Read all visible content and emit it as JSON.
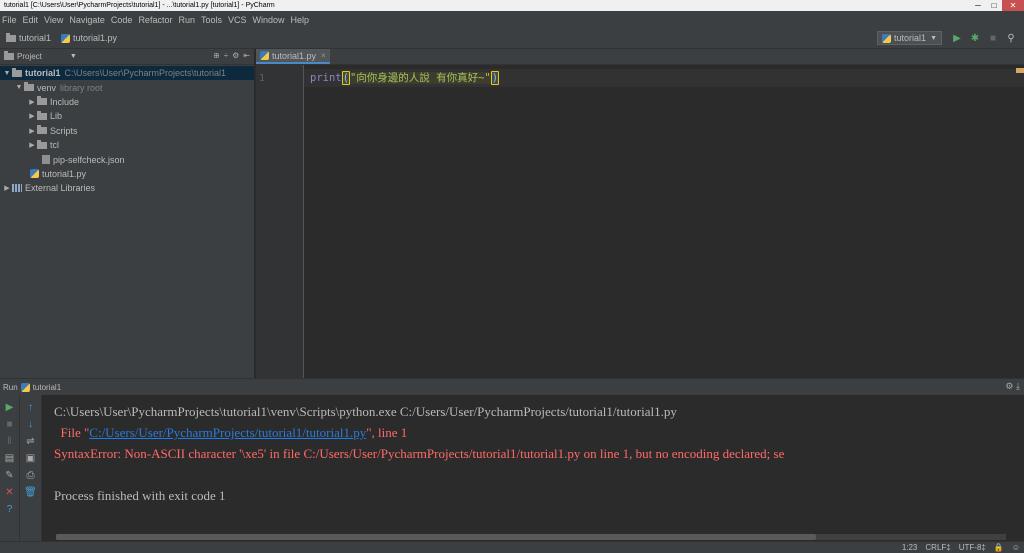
{
  "window": {
    "title": "tutorial1 [C:\\Users\\User\\PycharmProjects\\tutorial1] - ...\\tutorial1.py [tutorial1] - PyCharm",
    "controls": [
      "─",
      "□",
      "✕"
    ]
  },
  "menu": [
    "File",
    "Edit",
    "View",
    "Navigate",
    "Code",
    "Refactor",
    "Run",
    "Tools",
    "VCS",
    "Window",
    "Help"
  ],
  "breadcrumb": {
    "project": "tutorial1",
    "file": "tutorial1.py"
  },
  "toolbar": {
    "run_config": "tutorial1",
    "run_icon": "run-icon",
    "debug_icon": "debug-icon",
    "stop_icon": "stop-icon",
    "search_icon": "search-icon"
  },
  "project_panel": {
    "title": "Project",
    "tree": {
      "root_label": "tutorial1",
      "root_path": "C:\\Users\\User\\PycharmProjects\\tutorial1",
      "venv_label": "venv",
      "venv_hint": "library root",
      "include": "Include",
      "lib": "Lib",
      "scripts": "Scripts",
      "tcl": "tcl",
      "pip_file": "pip-selfcheck.json",
      "main_file": "tutorial1.py",
      "external": "External Libraries"
    }
  },
  "editor": {
    "tab_label": "tutorial1.py",
    "line_number": "1",
    "code_keyword": "print",
    "code_open": "(",
    "code_string": "\"向你身邊的人說 有你真好~\"",
    "code_close": ")"
  },
  "run_panel": {
    "title": "Run",
    "config": "tutorial1",
    "console": {
      "line1": "C:\\Users\\User\\PycharmProjects\\tutorial1\\venv\\Scripts\\python.exe C:/Users/User/PycharmProjects/tutorial1/tutorial1.py",
      "line2_prefix": "  File \"",
      "line2_link": "C:/Users/User/PycharmProjects/tutorial1/tutorial1.py",
      "line2_suffix": "\", line 1",
      "line3": "SyntaxError: Non-ASCII character '\\xe5' in file C:/Users/User/PycharmProjects/tutorial1/tutorial1.py on line 1, but no encoding declared; se",
      "line4": "Process finished with exit code 1"
    }
  },
  "status": {
    "position": "1:23",
    "line_sep": "CRLF‡",
    "encoding": "UTF-8‡"
  },
  "colors": {
    "background": "#2b2b2b",
    "panel": "#3c3f41",
    "selection": "#0d293e",
    "error": "#ff6b68",
    "link": "#287bde",
    "string": "#a5c25c",
    "keyword": "#8888c6"
  }
}
